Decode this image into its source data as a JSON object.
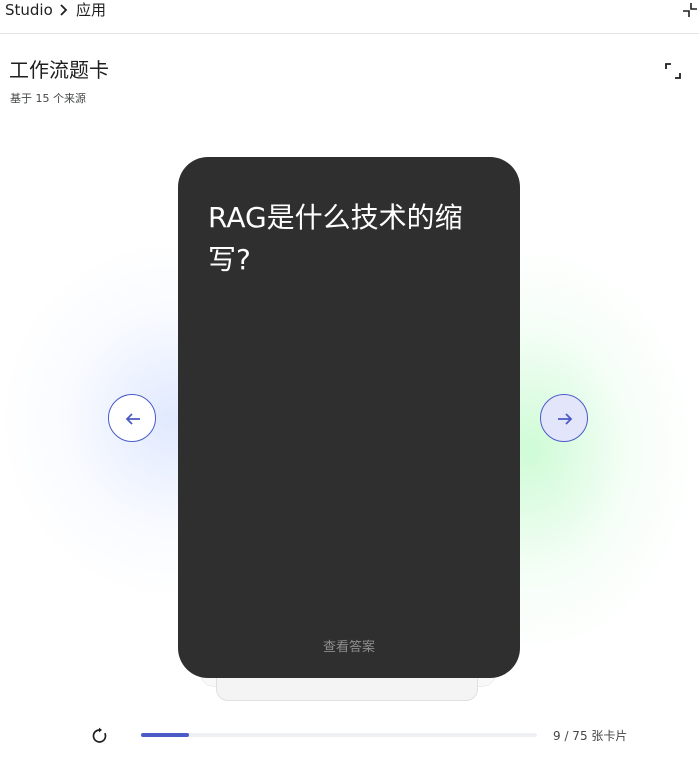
{
  "breadcrumb": {
    "root": "Studio",
    "current": "应用"
  },
  "header": {
    "title": "工作流题卡",
    "subtitle": "基于 15 个来源"
  },
  "card": {
    "question": "RAG是什么技术的缩写?",
    "reveal_label": "查看答案"
  },
  "progress": {
    "current": 9,
    "total": 75,
    "fraction": 0.12,
    "label": "9 / 75 张卡片"
  },
  "icons": {
    "breadcrumb_sep": "chevron-right-icon",
    "collapse": "collapse-icon",
    "expand": "fullscreen-icon",
    "prev": "arrow-left-icon",
    "next": "arrow-right-icon",
    "reset": "restart-icon"
  },
  "colors": {
    "accent": "#4a5bc7",
    "card_bg": "#2f2f2f",
    "next_bg": "#e3e6fb"
  }
}
